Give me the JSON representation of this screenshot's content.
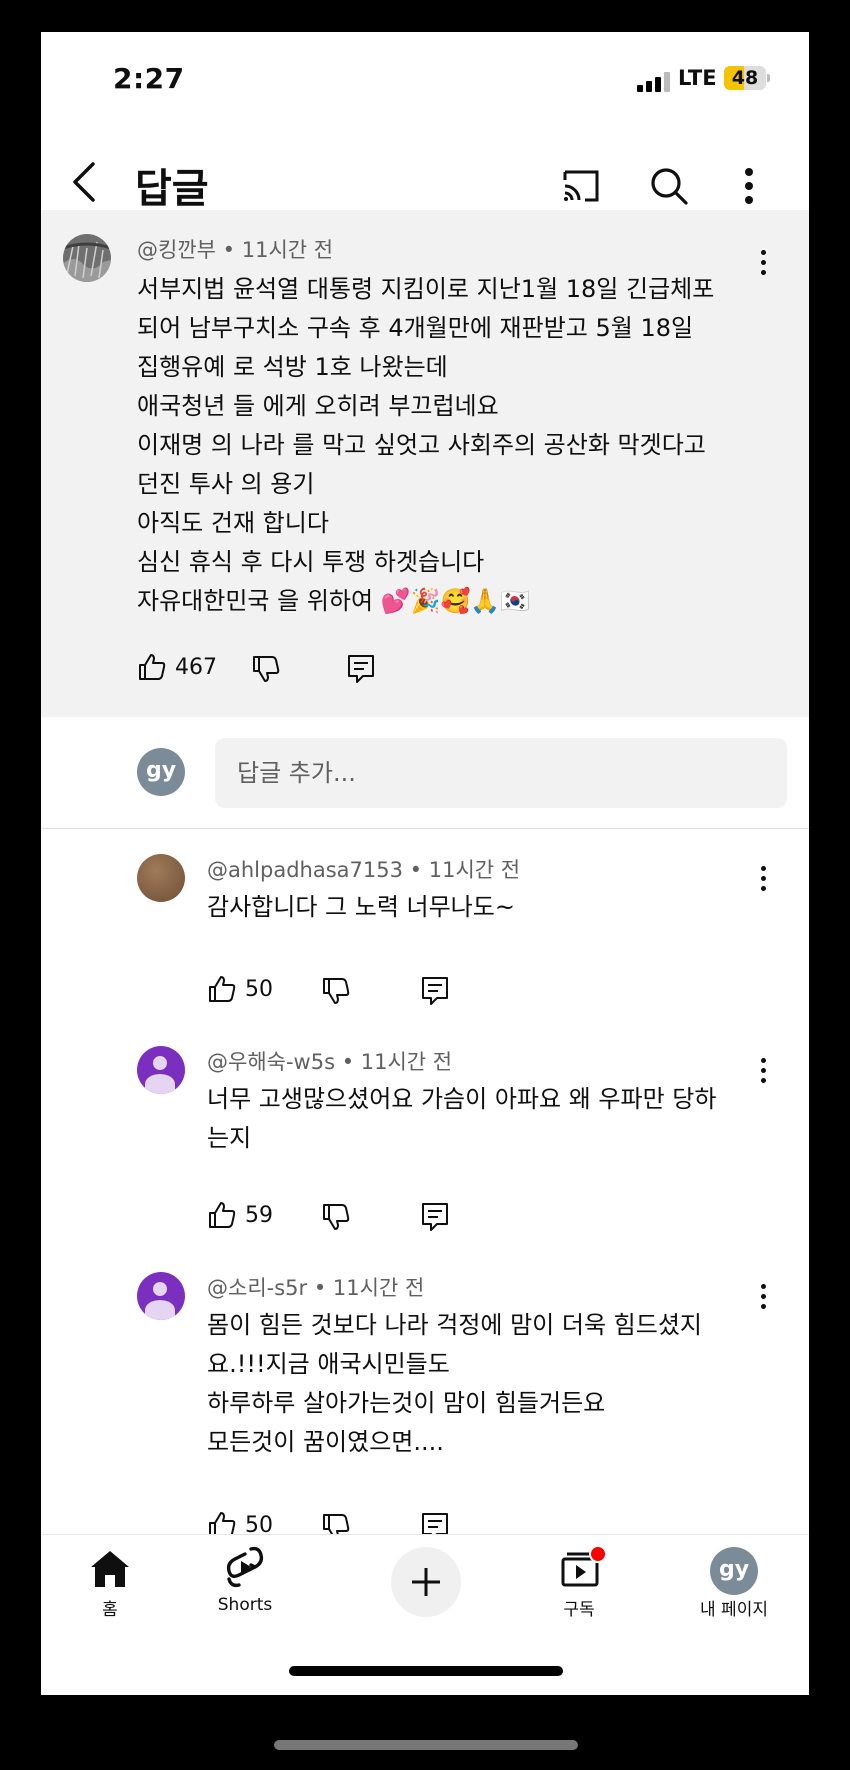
{
  "status_bar": {
    "time": "2:27",
    "network": "LTE",
    "battery": "48"
  },
  "app_bar": {
    "title": "답글",
    "icons": [
      "back-icon",
      "cast-icon",
      "search-icon",
      "more-icon"
    ]
  },
  "parent_comment": {
    "author": "@킹깐부",
    "time": "11시간 전",
    "lines": [
      "서부지법 윤석열 대통령 지킴이로 지난1월 18일 긴급체포",
      "되어 남부구치소 구속 후 4개월만에 재판받고 5월 18일",
      "집행유예 로 석방 1호 나왔는데",
      "애국청년 들 에게 오히려 부끄럽네요",
      "이재명 의 나라 를 막고 싶엇고 사회주의 공산화 막겟다고",
      "던진 투사 의 용기",
      "아직도 건재 합니다",
      "심신 휴식 후 다시 투쟁 하겟습니다",
      "자유대한민국 을 위하여 💕🎉🥰🙏🇰🇷"
    ],
    "likes": "467"
  },
  "add_reply": {
    "avatar": "gy",
    "placeholder": "답글 추가..."
  },
  "replies": [
    {
      "author": "@ahlpadhasa7153",
      "time": "11시간 전",
      "lines": [
        "감사합니다 그 노력 너무나도~"
      ],
      "likes": "50"
    },
    {
      "author": "@우해숙-w5s",
      "time": "11시간 전",
      "lines": [
        "너무 고생많으셨어요 가슴이 아파요 왜 우파만 당하",
        "는지"
      ],
      "likes": "59"
    },
    {
      "author": "@소리-s5r",
      "time": "11시간 전",
      "lines": [
        "몸이 힘든 것보다 나라 걱정에 맘이 더욱 힘드셨지",
        "요.!!!지금 애국시민들도",
        "하루하루 살아가는것이 맘이 힘들거든요",
        "모든것이 꿈이였으면...."
      ],
      "likes": "50"
    }
  ],
  "bottom_nav": {
    "home": "홈",
    "shorts": "Shorts",
    "subscriptions": "구독",
    "you": "내 페이지",
    "you_avatar": "gy"
  },
  "colors": {
    "secondary_text": "#606060",
    "parent_bg": "#f2f2f2",
    "notification_dot": "#ff0000",
    "avatar_gy": "#7b8b97"
  }
}
